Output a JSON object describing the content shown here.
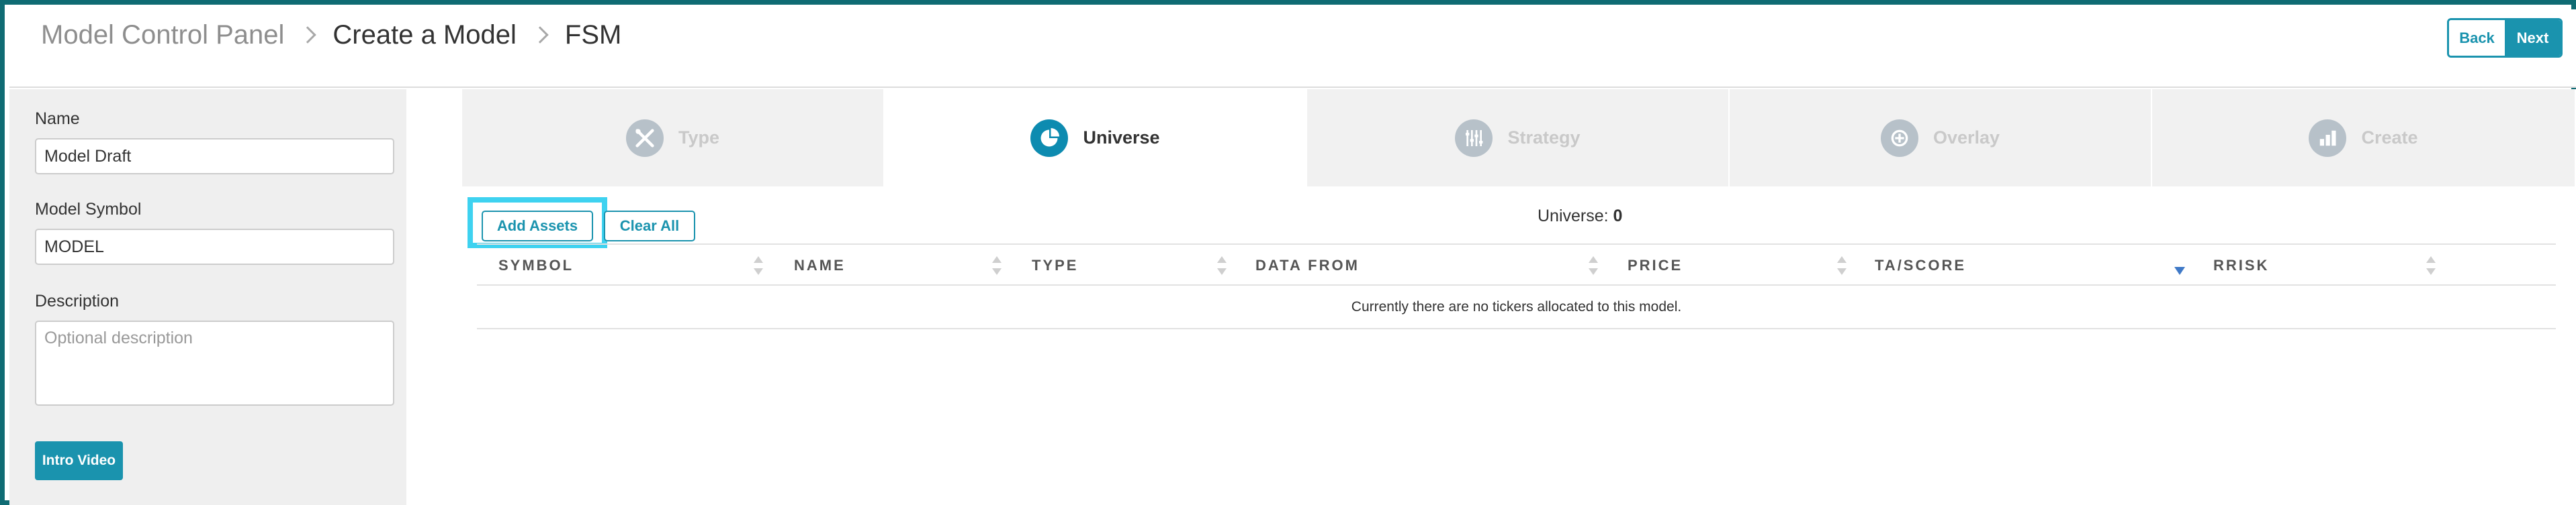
{
  "header": {
    "breadcrumb": [
      "Model Control Panel",
      "Create a Model",
      "FSM"
    ],
    "back_label": "Back",
    "next_label": "Next"
  },
  "sidebar": {
    "name_label": "Name",
    "name_value": "Model Draft",
    "symbol_label": "Model Symbol",
    "symbol_value": "MODEL",
    "description_label": "Description",
    "description_placeholder": "Optional description",
    "intro_video_label": "Intro Video"
  },
  "steps": [
    {
      "label": "Type",
      "icon": "tools-icon",
      "active": false
    },
    {
      "label": "Universe",
      "icon": "pie-chart-icon",
      "active": true
    },
    {
      "label": "Strategy",
      "icon": "sliders-icon",
      "active": false
    },
    {
      "label": "Overlay",
      "icon": "layers-icon",
      "active": false
    },
    {
      "label": "Create",
      "icon": "bar-chart-icon",
      "active": false
    }
  ],
  "toolbar": {
    "add_assets_label": "Add Assets",
    "clear_all_label": "Clear All",
    "universe_label": "Universe:",
    "universe_count": "0"
  },
  "table": {
    "columns": [
      "SYMBOL",
      "NAME",
      "TYPE",
      "DATA FROM",
      "PRICE",
      "TA/SCORE",
      "RRISK"
    ],
    "sorted_column": "TA/SCORE",
    "empty_message": "Currently there are no tickers allocated to this model."
  },
  "colors": {
    "frame": "#0f6b73",
    "accent": "#1a93ae",
    "active_step_icon": "#0d8bb0",
    "highlight": "#3ed2f0"
  }
}
